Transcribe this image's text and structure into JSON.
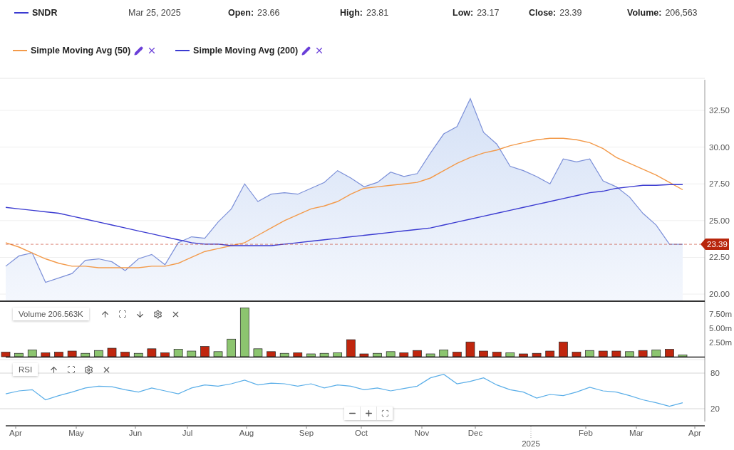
{
  "header": {
    "symbol": {
      "color": "#3b3bd1"
    },
    "date": "Mar 25, 2025",
    "fields": [
      {
        "label": "Open:",
        "value": "23.66"
      },
      {
        "label": "High:",
        "value": "23.81"
      },
      {
        "label": "Low:",
        "value": "23.17"
      },
      {
        "label": "Close:",
        "value": "23.39"
      },
      {
        "label": "Volume:",
        "value": "206,563"
      }
    ]
  },
  "price_chart": {
    "last_price": "23.39",
    "chart_data": {
      "type": "line",
      "grid": true,
      "ref_lines": [
        {
          "axis": "y",
          "value": 23.39,
          "color": "#c0260e"
        }
      ],
      "ylim": [
        19.52,
        34.68
      ],
      "yticks": [
        {
          "value": 20,
          "label": "20.00"
        },
        {
          "value": 22.5,
          "label": "22.50"
        },
        {
          "value": 25,
          "label": "25.00"
        },
        {
          "value": 27.5,
          "label": "27.50"
        },
        {
          "value": 30,
          "label": "30.00"
        },
        {
          "value": 32.5,
          "label": "32.50"
        }
      ],
      "series": [
        {
          "name": "SNDR",
          "type": "area",
          "color": "#7b8fd8",
          "values": [
            21.9,
            22.6,
            22.8,
            20.8,
            21.1,
            21.4,
            22.3,
            22.4,
            22.2,
            21.6,
            22.4,
            22.7,
            22.0,
            23.5,
            23.9,
            23.8,
            24.9,
            25.8,
            27.5,
            26.3,
            26.8,
            26.9,
            26.8,
            27.2,
            27.6,
            28.4,
            27.9,
            27.3,
            27.6,
            28.3,
            28.0,
            28.2,
            29.6,
            30.9,
            31.4,
            33.3,
            31.0,
            30.2,
            28.7,
            28.4,
            28.0,
            27.5,
            29.2,
            29.0,
            29.2,
            27.7,
            27.3,
            26.6,
            25.5,
            24.7,
            23.4,
            23.39
          ]
        },
        {
          "name": "Simple Moving Avg (50)",
          "type": "line",
          "color": "#f39a4a",
          "values": [
            23.5,
            23.2,
            22.8,
            22.4,
            22.1,
            21.9,
            21.9,
            21.8,
            21.8,
            21.8,
            21.8,
            21.9,
            21.9,
            22.1,
            22.5,
            22.9,
            23.1,
            23.3,
            23.5,
            24.0,
            24.5,
            25.0,
            25.4,
            25.8,
            26.0,
            26.3,
            26.8,
            27.2,
            27.3,
            27.4,
            27.5,
            27.6,
            27.9,
            28.4,
            28.9,
            29.3,
            29.6,
            29.8,
            30.1,
            30.3,
            30.5,
            30.6,
            30.6,
            30.5,
            30.3,
            29.9,
            29.3,
            28.9,
            28.5,
            28.1,
            27.6,
            27.1
          ]
        },
        {
          "name": "Simple Moving Avg (200)",
          "type": "line",
          "color": "#3b3bd1",
          "values": [
            25.9,
            25.8,
            25.7,
            25.6,
            25.5,
            25.3,
            25.1,
            24.9,
            24.7,
            24.5,
            24.3,
            24.1,
            23.9,
            23.7,
            23.5,
            23.4,
            23.4,
            23.3,
            23.3,
            23.3,
            23.3,
            23.4,
            23.5,
            23.6,
            23.7,
            23.8,
            23.9,
            24.0,
            24.1,
            24.2,
            24.3,
            24.4,
            24.5,
            24.7,
            24.9,
            25.1,
            25.3,
            25.5,
            25.7,
            25.9,
            26.1,
            26.3,
            26.5,
            26.7,
            26.9,
            27.0,
            27.2,
            27.3,
            27.4,
            27.4,
            27.45,
            27.45
          ]
        }
      ]
    }
  },
  "volume_pane": {
    "title": "Volume 206.563K",
    "chart_data": {
      "type": "bar",
      "stacked": true,
      "ylim": [
        0,
        8.9
      ],
      "yticks": [
        {
          "value": 2.5,
          "label": "2.50m"
        },
        {
          "value": 5,
          "label": "5.00m"
        },
        {
          "value": 7.5,
          "label": "7.50m"
        }
      ],
      "series": [
        {
          "color": "#8cc56f",
          "values": [
            null,
            0.6,
            1.2,
            null,
            null,
            null,
            0.6,
            1.1,
            null,
            null,
            0.6,
            null,
            null,
            1.3,
            1.0,
            null,
            0.9,
            3.1,
            8.6,
            1.4,
            null,
            0.6,
            null,
            0.5,
            0.6,
            0.7,
            null,
            null,
            0.6,
            0.9,
            null,
            null,
            0.5,
            1.2,
            null,
            null,
            null,
            null,
            0.7,
            null,
            null,
            null,
            null,
            null,
            1.1,
            null,
            null,
            0.9,
            null,
            1.2,
            null,
            0.3
          ]
        },
        {
          "color": "#c0260e",
          "values": [
            0.8,
            null,
            null,
            0.7,
            0.8,
            1.0,
            null,
            null,
            1.5,
            0.8,
            null,
            1.4,
            0.7,
            null,
            null,
            1.8,
            null,
            null,
            null,
            null,
            0.9,
            null,
            0.7,
            null,
            null,
            null,
            3.0,
            0.5,
            null,
            null,
            0.7,
            1.1,
            null,
            null,
            0.8,
            2.6,
            1.0,
            0.8,
            null,
            0.5,
            0.6,
            1.0,
            2.6,
            0.8,
            null,
            1.0,
            1.0,
            null,
            1.1,
            null,
            1.3,
            null
          ]
        }
      ]
    }
  },
  "x_axis": {
    "ticks": [
      {
        "label": "Apr",
        "kind": "month"
      },
      {
        "label": "May",
        "kind": "month"
      },
      {
        "label": "Jun",
        "kind": "month"
      },
      {
        "label": "Jul",
        "kind": "month"
      },
      {
        "label": "Aug",
        "kind": "month"
      },
      {
        "label": "Sep",
        "kind": "month"
      },
      {
        "label": "Oct",
        "kind": "month"
      },
      {
        "label": "Nov",
        "kind": "month"
      },
      {
        "label": "Dec",
        "kind": "month"
      },
      {
        "label": "2025",
        "kind": "year"
      },
      {
        "label": "Feb",
        "kind": "month"
      },
      {
        "label": "Mar",
        "kind": "month"
      },
      {
        "label": "Apr",
        "kind": "month"
      }
    ]
  },
  "rsi_pane": {
    "chart_data": {
      "type": "line",
      "ylim": [
        0.8,
        102.8
      ],
      "yticks": [
        20,
        80
      ],
      "series": [
        {
          "name": "RSI",
          "color": "#5aaee8",
          "values": [
            45,
            50,
            52,
            35,
            42,
            48,
            55,
            58,
            57,
            52,
            48,
            55,
            50,
            45,
            55,
            60,
            58,
            62,
            68,
            60,
            63,
            62,
            58,
            62,
            55,
            60,
            58,
            52,
            55,
            50,
            54,
            58,
            72,
            78,
            62,
            66,
            72,
            60,
            52,
            48,
            38,
            44,
            42,
            48,
            56,
            50,
            48,
            42,
            35,
            30,
            24,
            30
          ]
        }
      ]
    }
  }
}
